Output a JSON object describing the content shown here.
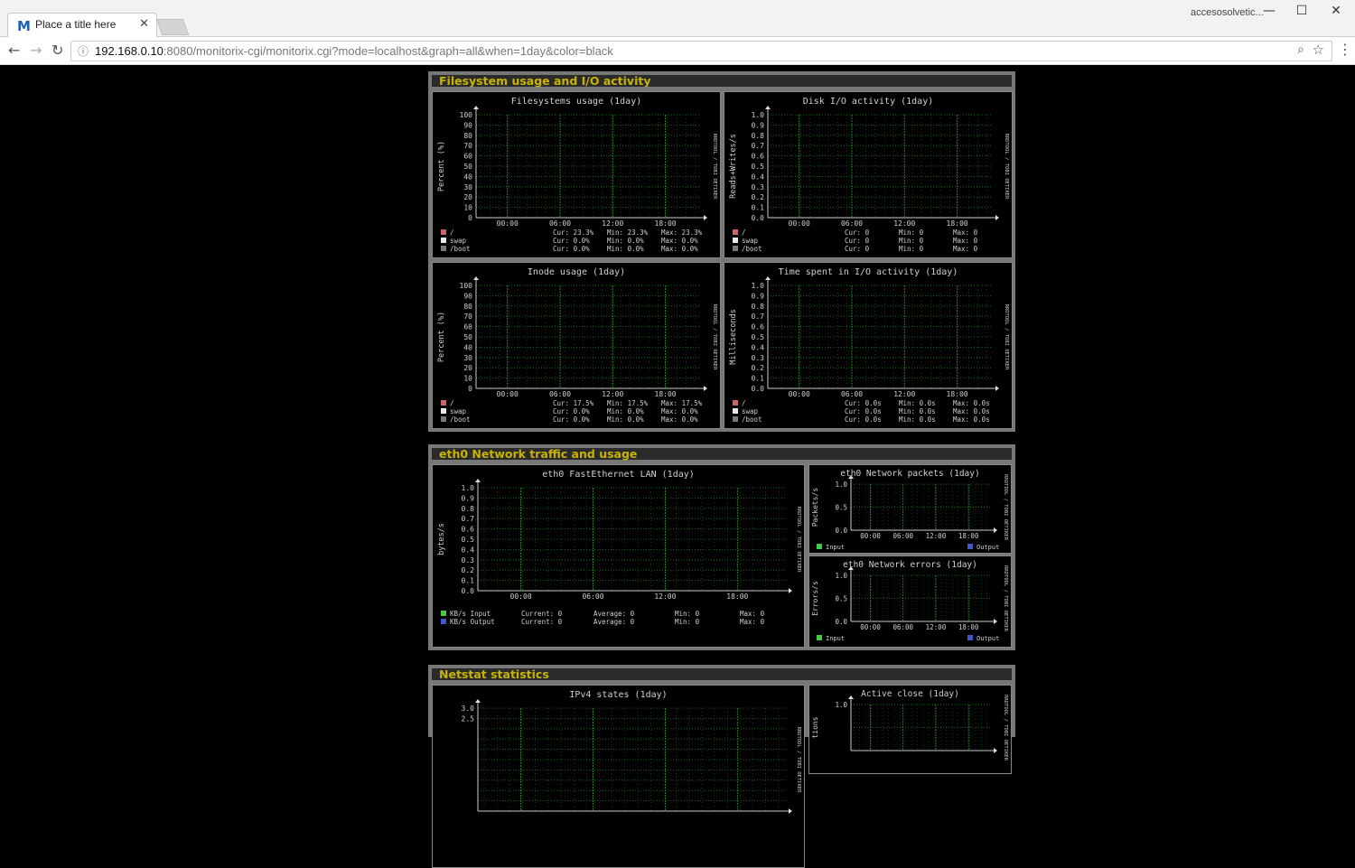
{
  "browser": {
    "tab_title": "Place a title here",
    "tab_favicon": "M",
    "tab_close": "✕",
    "profile_label": "accesosolvetic...",
    "url_host": "192.168.0.10",
    "url_rest": ":8080/monitorix-cgi/monitorix.cgi?mode=localhost&graph=all&when=1day&color=black",
    "icons": {
      "back": "back-arrow-icon",
      "forward": "forward-arrow-icon",
      "reload": "reload-icon",
      "info": "info-icon",
      "zoom": "zoom-icon",
      "star": "bookmark-star-icon",
      "menu": "kebab-menu-icon"
    }
  },
  "sections": {
    "filesystem": {
      "title": "Filesystem usage and I/O activity"
    },
    "network": {
      "title": "eth0 Network traffic and usage"
    },
    "netstat": {
      "title": "Netstat statistics"
    }
  },
  "colors": {
    "section_title": "#c8b400",
    "panel_bg": "#777777",
    "grid": "#1e7a1e",
    "text": "#d0d0d0",
    "root": "#cc6666",
    "swap": "#e8e8e8",
    "boot": "#7a7a7a",
    "input": "#44cc44",
    "output": "#4455cc"
  },
  "graphs": {
    "fs_usage": {
      "title": "Filesystems usage  (1day)",
      "ylabel": "Percent (%)",
      "watermark": "RRDTOOL / TOBI OETIKER",
      "yticks": [
        "100",
        "90",
        "80",
        "70",
        "60",
        "50",
        "40",
        "30",
        "20",
        "10",
        "0"
      ],
      "xticks": [
        "00:00",
        "06:00",
        "12:00",
        "18:00"
      ],
      "legend": [
        {
          "name": "/",
          "color": "#cc6666",
          "stats": [
            "Cur:  23.3%",
            "Min:  23.3%",
            "Max:  23.3%"
          ]
        },
        {
          "name": "swap",
          "color": "#e8e8e8",
          "stats": [
            "Cur:   0.0%",
            "Min:   0.0%",
            "Max:   0.0%"
          ]
        },
        {
          "name": "/boot",
          "color": "#7a7a7a",
          "stats": [
            "Cur:   0.0%",
            "Min:   0.0%",
            "Max:   0.0%"
          ]
        }
      ]
    },
    "disk_io": {
      "title": "Disk I/O activity  (1day)",
      "ylabel": "Reads+Writes/s",
      "watermark": "RRDTOOL / TOBI OETIKER",
      "yticks": [
        "1.0",
        "0.9",
        "0.8",
        "0.7",
        "0.6",
        "0.5",
        "0.4",
        "0.3",
        "0.2",
        "0.1",
        "0.0"
      ],
      "xticks": [
        "00:00",
        "06:00",
        "12:00",
        "18:00"
      ],
      "legend": [
        {
          "name": "/",
          "color": "#cc6666",
          "stats": [
            "Cur:      0",
            "Min:      0",
            "Max:      0"
          ]
        },
        {
          "name": "swap",
          "color": "#e8e8e8",
          "stats": [
            "Cur:      0",
            "Min:      0",
            "Max:      0"
          ]
        },
        {
          "name": "/boot",
          "color": "#7a7a7a",
          "stats": [
            "Cur:      0",
            "Min:      0",
            "Max:      0"
          ]
        }
      ]
    },
    "inode": {
      "title": "Inode usage  (1day)",
      "ylabel": "Percent (%)",
      "watermark": "RRDTOOL / TOBI OETIKER",
      "yticks": [
        "100",
        "90",
        "80",
        "70",
        "60",
        "50",
        "40",
        "30",
        "20",
        "10",
        "0"
      ],
      "xticks": [
        "00:00",
        "06:00",
        "12:00",
        "18:00"
      ],
      "legend": [
        {
          "name": "/",
          "color": "#cc6666",
          "stats": [
            "Cur:  17.5%",
            "Min:  17.5%",
            "Max:  17.5%"
          ]
        },
        {
          "name": "swap",
          "color": "#e8e8e8",
          "stats": [
            "Cur:   0.0%",
            "Min:   0.0%",
            "Max:   0.0%"
          ]
        },
        {
          "name": "/boot",
          "color": "#7a7a7a",
          "stats": [
            "Cur:   0.0%",
            "Min:   0.0%",
            "Max:   0.0%"
          ]
        }
      ]
    },
    "io_time": {
      "title": "Time spent in I/O activity  (1day)",
      "ylabel": "Milliseconds",
      "watermark": "RRDTOOL / TOBI OETIKER",
      "yticks": [
        "1.0",
        "0.9",
        "0.8",
        "0.7",
        "0.6",
        "0.5",
        "0.4",
        "0.3",
        "0.2",
        "0.1",
        "0.0"
      ],
      "xticks": [
        "00:00",
        "06:00",
        "12:00",
        "18:00"
      ],
      "legend": [
        {
          "name": "/",
          "color": "#cc6666",
          "stats": [
            "Cur:   0.0s",
            "Min:   0.0s",
            "Max:   0.0s"
          ]
        },
        {
          "name": "swap",
          "color": "#e8e8e8",
          "stats": [
            "Cur:   0.0s",
            "Min:   0.0s",
            "Max:   0.0s"
          ]
        },
        {
          "name": "/boot",
          "color": "#7a7a7a",
          "stats": [
            "Cur:   0.0s",
            "Min:   0.0s",
            "Max:   0.0s"
          ]
        }
      ]
    },
    "eth0_traffic": {
      "title": "eth0 FastEthernet LAN  (1day)",
      "ylabel": "bytes/s",
      "watermark": "RRDTOOL / TOBI OETIKER",
      "yticks": [
        "1.0",
        "0.9",
        "0.8",
        "0.7",
        "0.6",
        "0.5",
        "0.4",
        "0.3",
        "0.2",
        "0.1",
        "0.0"
      ],
      "xticks": [
        "00:00",
        "06:00",
        "12:00",
        "18:00"
      ],
      "legend": [
        {
          "name": "KB/s Input",
          "color": "#44cc44",
          "stats": [
            "Current:      0",
            "Average:      0",
            "Min:      0",
            "Max:      0"
          ]
        },
        {
          "name": "KB/s Output",
          "color": "#4455cc",
          "stats": [
            "Current:      0",
            "Average:      0",
            "Min:      0",
            "Max:      0"
          ]
        }
      ]
    },
    "eth0_packets": {
      "title": "eth0 Network packets  (1day)",
      "ylabel": "Packets/s",
      "watermark": "RRDTOOL / TOBI OETIKER",
      "yticks": [
        "1.0",
        "0.5",
        "0.0"
      ],
      "xticks": [
        "00:00",
        "06:00",
        "12:00",
        "18:00"
      ],
      "legend": [
        {
          "name": "Input",
          "color": "#44cc44"
        },
        {
          "name": "Output",
          "color": "#4455cc"
        }
      ]
    },
    "eth0_errors": {
      "title": "eth0 Network errors  (1day)",
      "ylabel": "Errors/s",
      "watermark": "RRDTOOL / TOBI OETIKER",
      "yticks": [
        "1.0",
        "0.5",
        "0.0"
      ],
      "xticks": [
        "00:00",
        "06:00",
        "12:00",
        "18:00"
      ],
      "legend": [
        {
          "name": "Input",
          "color": "#44cc44"
        },
        {
          "name": "Output",
          "color": "#4455cc"
        }
      ]
    },
    "ipv4_states": {
      "title": "IPv4 states  (1day)",
      "ylabel": "",
      "watermark": "RRDTOOL / TOBI OETIKER",
      "yticks": [
        "3.0",
        "2.5"
      ],
      "xticks": [],
      "legend": []
    },
    "active_close": {
      "title": "Active close  (1day)",
      "ylabel": "tions",
      "watermark": "RRDTOOL / TOBI OETIKER",
      "yticks": [
        "1.0"
      ],
      "xticks": [],
      "legend": []
    }
  }
}
